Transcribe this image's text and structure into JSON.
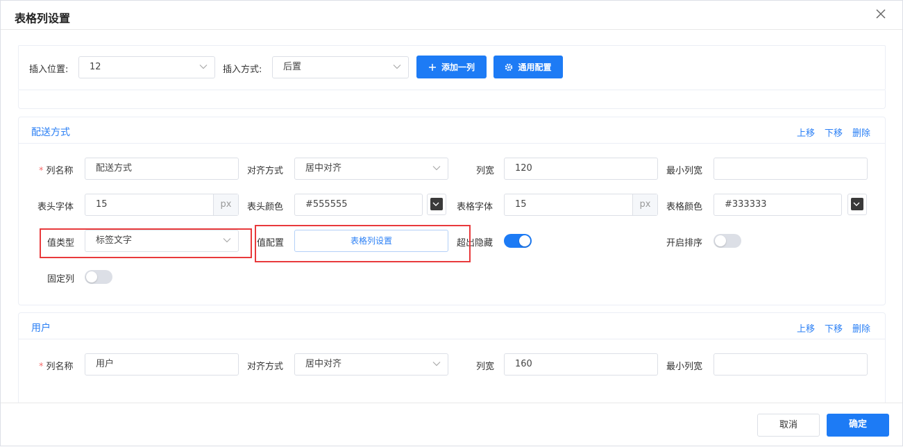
{
  "dialog": {
    "title": "表格列设置"
  },
  "toolbar": {
    "insert_position_label": "插入位置:",
    "insert_position_value": "12",
    "insert_mode_label": "插入方式:",
    "insert_mode_value": "后置",
    "add_column_label": "添加一列",
    "general_config_label": "通用配置"
  },
  "actions": {
    "move_up": "上移",
    "move_down": "下移",
    "delete": "删除"
  },
  "labels": {
    "required_mark": "*",
    "column_name": "列名称",
    "align": "对齐方式",
    "width": "列宽",
    "min_width": "最小列宽",
    "header_font": "表头字体",
    "header_color": "表头颜色",
    "cell_font": "表格字体",
    "cell_color": "表格颜色",
    "value_type": "值类型",
    "value_config": "值配置",
    "overflow_hidden": "超出隐藏",
    "enable_sort": "开启排序",
    "fixed_column": "固定列",
    "px": "px"
  },
  "columns": [
    {
      "title": "配送方式",
      "column_name": "配送方式",
      "align": "居中对齐",
      "width": "120",
      "min_width": "",
      "header_font": "15",
      "header_color": "#555555",
      "cell_font": "15",
      "cell_color": "#333333",
      "value_type": "标签文字",
      "value_config_button": "表格列设置",
      "overflow_hidden": true,
      "enable_sort": false,
      "fixed_column": false
    },
    {
      "title": "用户",
      "column_name": "用户",
      "align": "居中对齐",
      "width": "160",
      "min_width": ""
    }
  ],
  "footer": {
    "cancel": "取消",
    "confirm": "确定"
  },
  "colors": {
    "primary": "#1d7bf5",
    "highlight": "#e8393b",
    "swatch": "#3a3a3a"
  }
}
